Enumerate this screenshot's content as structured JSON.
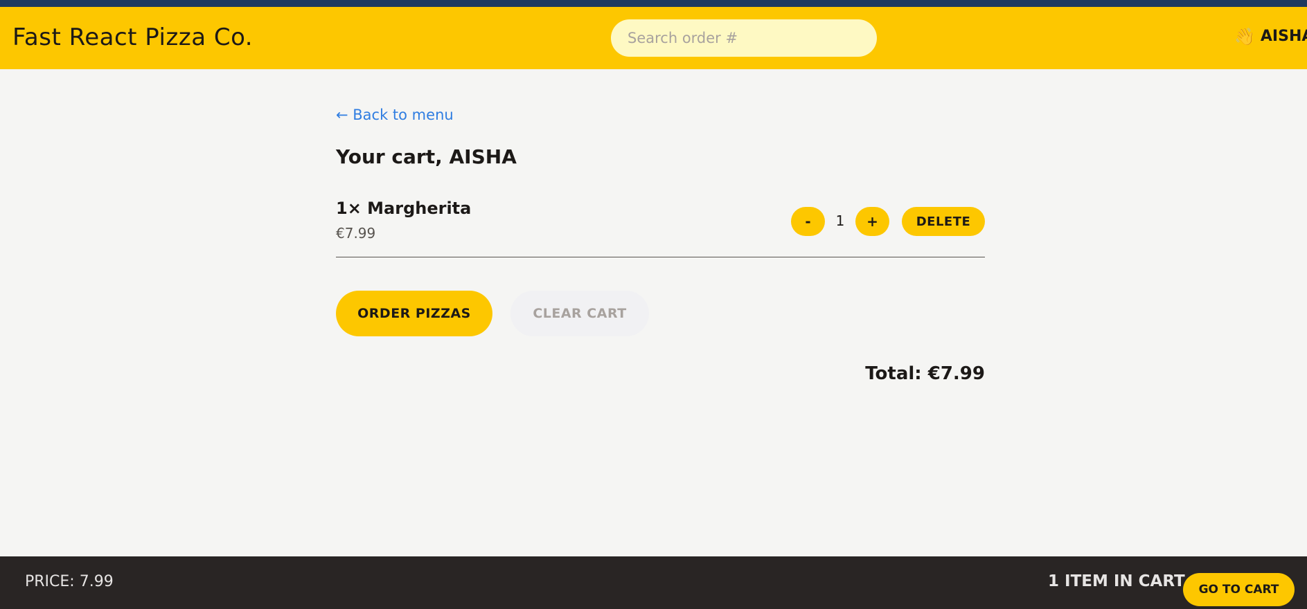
{
  "header": {
    "brand": "Fast React Pizza Co.",
    "search_placeholder": "Search order #",
    "user_name": "AISHA"
  },
  "cart": {
    "back_link": "← Back to menu",
    "title": "Your cart, AISHA",
    "items": [
      {
        "name": "1× Margherita",
        "price": "€7.99",
        "quantity": "1",
        "decrement_label": "-",
        "increment_label": "+",
        "delete_label": "DELETE"
      }
    ],
    "order_button": "ORDER PIZZAS",
    "clear_button": "CLEAR CART",
    "total": "Total: €7.99"
  },
  "footer": {
    "price": "PRICE: 7.99",
    "count": "1 ITEM IN CART",
    "go_button": "GO TO CART"
  },
  "colors": {
    "brand_yellow": "#fdc700",
    "top_strip": "#1e3a5f",
    "footer_bg": "#292524",
    "link_blue": "#2f7de1"
  },
  "icons": {
    "user": "waving-hand-icon"
  }
}
